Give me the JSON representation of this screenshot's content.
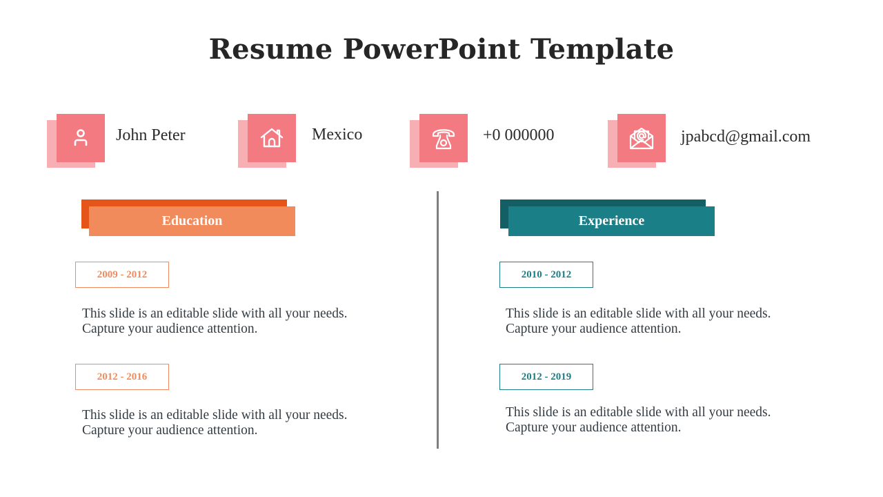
{
  "title": "Resume PowerPoint Template",
  "colors": {
    "icon_front": "#f47a82",
    "icon_back": "#f8afb4",
    "education_primary": "#f28b5c",
    "education_dark": "#e55419",
    "experience_primary": "#1a7f87",
    "experience_dark": "#145f66",
    "divider": "#7f7f7f"
  },
  "contacts": [
    {
      "icon": "user-icon",
      "label": "John Peter"
    },
    {
      "icon": "home-icon",
      "label": "Mexico"
    },
    {
      "icon": "telephone-icon",
      "label": "+0 000000"
    },
    {
      "icon": "email-icon",
      "label": "jpabcd@gmail.com"
    }
  ],
  "education": {
    "heading": "Education",
    "entries": [
      {
        "period": "2009 - 2012",
        "text": "This slide is an editable slide with all your needs. Capture your audience attention."
      },
      {
        "period": "2012 - 2016",
        "text": "This slide is an editable slide with all your needs. Capture your audience attention."
      }
    ]
  },
  "experience": {
    "heading": "Experience",
    "entries": [
      {
        "period": "2010 - 2012",
        "text": "This slide is an editable slide with all your needs. Capture your audience attention."
      },
      {
        "period": "2012 - 2019",
        "text": "This slide is an editable slide with all your needs. Capture your audience attention."
      }
    ]
  }
}
